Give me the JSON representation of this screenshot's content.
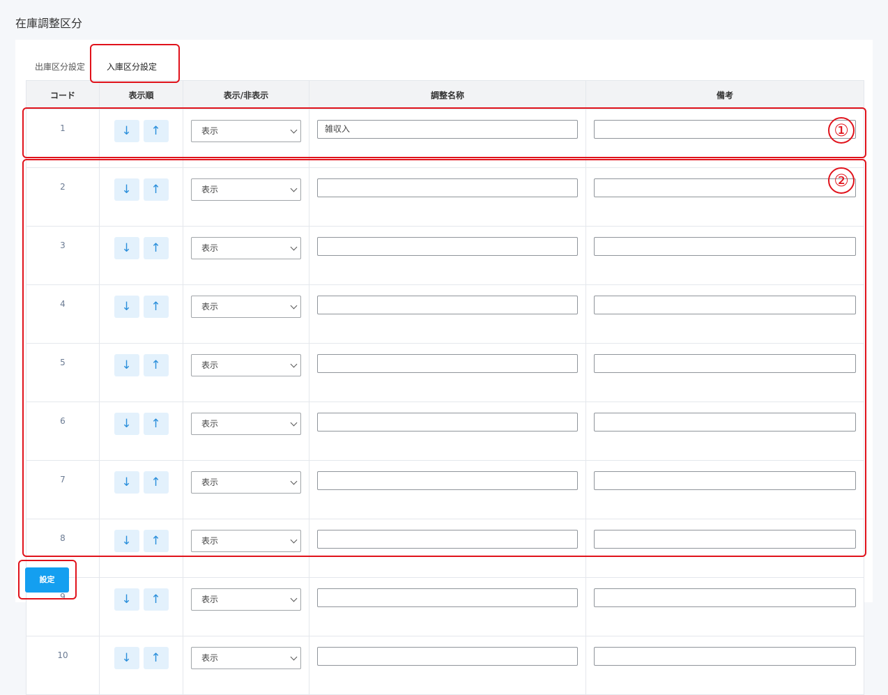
{
  "page": {
    "title": "在庫調整区分"
  },
  "tabs": [
    {
      "label": "出庫区分設定"
    },
    {
      "label": "入庫区分設定"
    }
  ],
  "table": {
    "headers": {
      "code": "コード",
      "order": "表示順",
      "visibility": "表示/非表示",
      "name": "調整名称",
      "note": "備考"
    },
    "down_label": "↓",
    "up_label": "↑",
    "rows": [
      {
        "code": "1",
        "visibility": "表示",
        "name": "雑収入",
        "note": ""
      },
      {
        "code": "2",
        "visibility": "表示",
        "name": "",
        "note": ""
      },
      {
        "code": "3",
        "visibility": "表示",
        "name": "",
        "note": ""
      },
      {
        "code": "4",
        "visibility": "表示",
        "name": "",
        "note": ""
      },
      {
        "code": "5",
        "visibility": "表示",
        "name": "",
        "note": ""
      },
      {
        "code": "6",
        "visibility": "表示",
        "name": "",
        "note": ""
      },
      {
        "code": "7",
        "visibility": "表示",
        "name": "",
        "note": ""
      },
      {
        "code": "8",
        "visibility": "表示",
        "name": "",
        "note": ""
      },
      {
        "code": "9",
        "visibility": "表示",
        "name": "",
        "note": ""
      },
      {
        "code": "10",
        "visibility": "表示",
        "name": "",
        "note": ""
      }
    ]
  },
  "submit": {
    "label": "設定"
  },
  "annotations": {
    "marker_1": "①",
    "marker_2": "②",
    "color": "#e0121b"
  },
  "colors": {
    "primary": "#149ff0",
    "arrow_button_bg": "#e3f1fc",
    "arrow": "#2b8fdb",
    "page_bg": "#f5f7fa"
  }
}
